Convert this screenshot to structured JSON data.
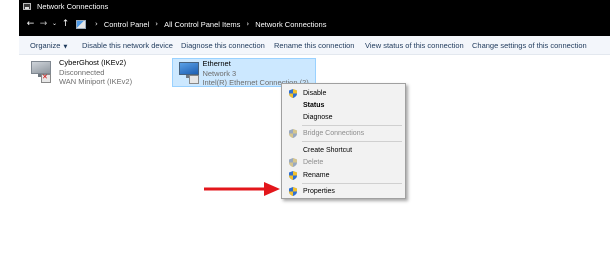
{
  "window": {
    "title": "Network Connections"
  },
  "address_bar": {
    "back": "←",
    "forward": "→",
    "recent": "⌄",
    "up": "↑",
    "breadcrumbs": [
      "Control Panel",
      "All Control Panel Items",
      "Network Connections"
    ],
    "separator": "›"
  },
  "toolbar": {
    "items": [
      "Organize",
      "Disable this network device",
      "Diagnose this connection",
      "Rename this connection",
      "View status of this connection",
      "Change settings of this connection"
    ],
    "organize_caret": "▼"
  },
  "connections": [
    {
      "name": "CyberGhost (IKEv2)",
      "status": "Disconnected",
      "device": "WAN Miniport (IKEv2)",
      "icon": "network-adapter-disconnected-icon"
    },
    {
      "name": "Ethernet",
      "status": "Network 3",
      "device": "Intel(R) Ethernet Connection (2)...",
      "icon": "network-adapter-icon",
      "selected": true
    }
  ],
  "context_menu": {
    "items": [
      {
        "label": "Disable",
        "icon": "shield-icon",
        "disabled": false,
        "bold": false
      },
      {
        "label": "Status",
        "icon": "",
        "disabled": false,
        "bold": true
      },
      {
        "label": "Diagnose",
        "icon": "",
        "disabled": false,
        "bold": false
      },
      {
        "label": "Bridge Connections",
        "icon": "shield-icon",
        "disabled": true,
        "bold": false
      },
      {
        "label": "Create Shortcut",
        "icon": "",
        "disabled": false,
        "bold": false
      },
      {
        "label": "Delete",
        "icon": "shield-icon",
        "disabled": true,
        "bold": false
      },
      {
        "label": "Rename",
        "icon": "shield-icon",
        "disabled": false,
        "bold": false
      },
      {
        "label": "Properties",
        "icon": "shield-icon",
        "disabled": false,
        "bold": false
      }
    ]
  },
  "annotation": {
    "arrow_color": "#e3161b"
  },
  "colors": {
    "titlebar": "#000000",
    "toolbar_text": "#1e395b",
    "selection_bg": "#cce8ff",
    "selection_border": "#99d1ff",
    "menu_bg": "#f2f2f2"
  }
}
